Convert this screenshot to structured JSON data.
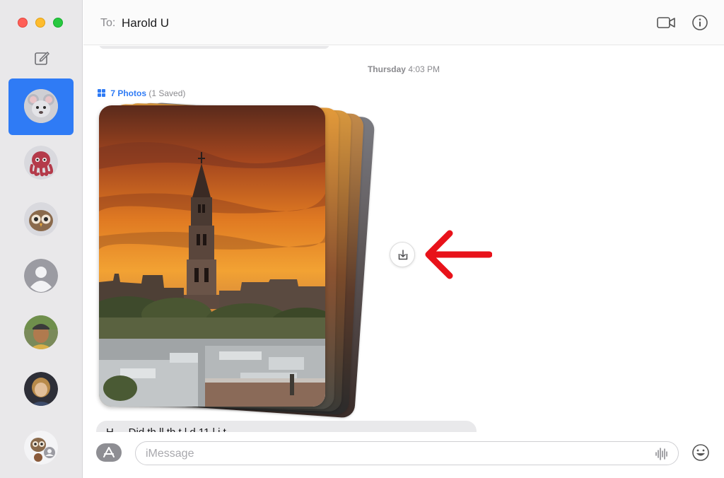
{
  "window": {
    "controls": [
      "close",
      "minimize",
      "maximize"
    ]
  },
  "sidebar": {
    "compose_icon": "compose-icon",
    "conversations": [
      {
        "id": "harold",
        "avatar": "mouse-memoji",
        "selected": true
      },
      {
        "id": "octopus",
        "avatar": "octopus-memoji",
        "selected": false
      },
      {
        "id": "owl",
        "avatar": "owl-memoji",
        "selected": false
      },
      {
        "id": "unknown",
        "avatar": "generic-person",
        "selected": false
      },
      {
        "id": "photo-contact-1",
        "avatar": "photo",
        "selected": false
      },
      {
        "id": "photo-contact-2",
        "avatar": "photo",
        "selected": false
      },
      {
        "id": "group",
        "avatar": "group-memoji",
        "selected": false
      }
    ]
  },
  "header": {
    "to_label": "To:",
    "recipient": "Harold U",
    "video_icon": "video-camera-icon",
    "info_icon": "info-icon"
  },
  "conversation": {
    "timestamp_day": "Thursday",
    "timestamp_time": "4:03 PM",
    "photos_count": "7 Photos",
    "photos_saved": "(1 Saved)",
    "next_message_preview": "H  ...  Did th    ll  th  t  l    d 11        l  i  t"
  },
  "input": {
    "placeholder": "iMessage",
    "value": "",
    "apps_icon": "app-store-icon",
    "audio_icon": "waveform-icon",
    "emoji_icon": "emoji-icon"
  },
  "colors": {
    "accent": "#2f7bf5",
    "annotation": "#e8121a",
    "sidebar_bg": "#e9e8ea"
  }
}
